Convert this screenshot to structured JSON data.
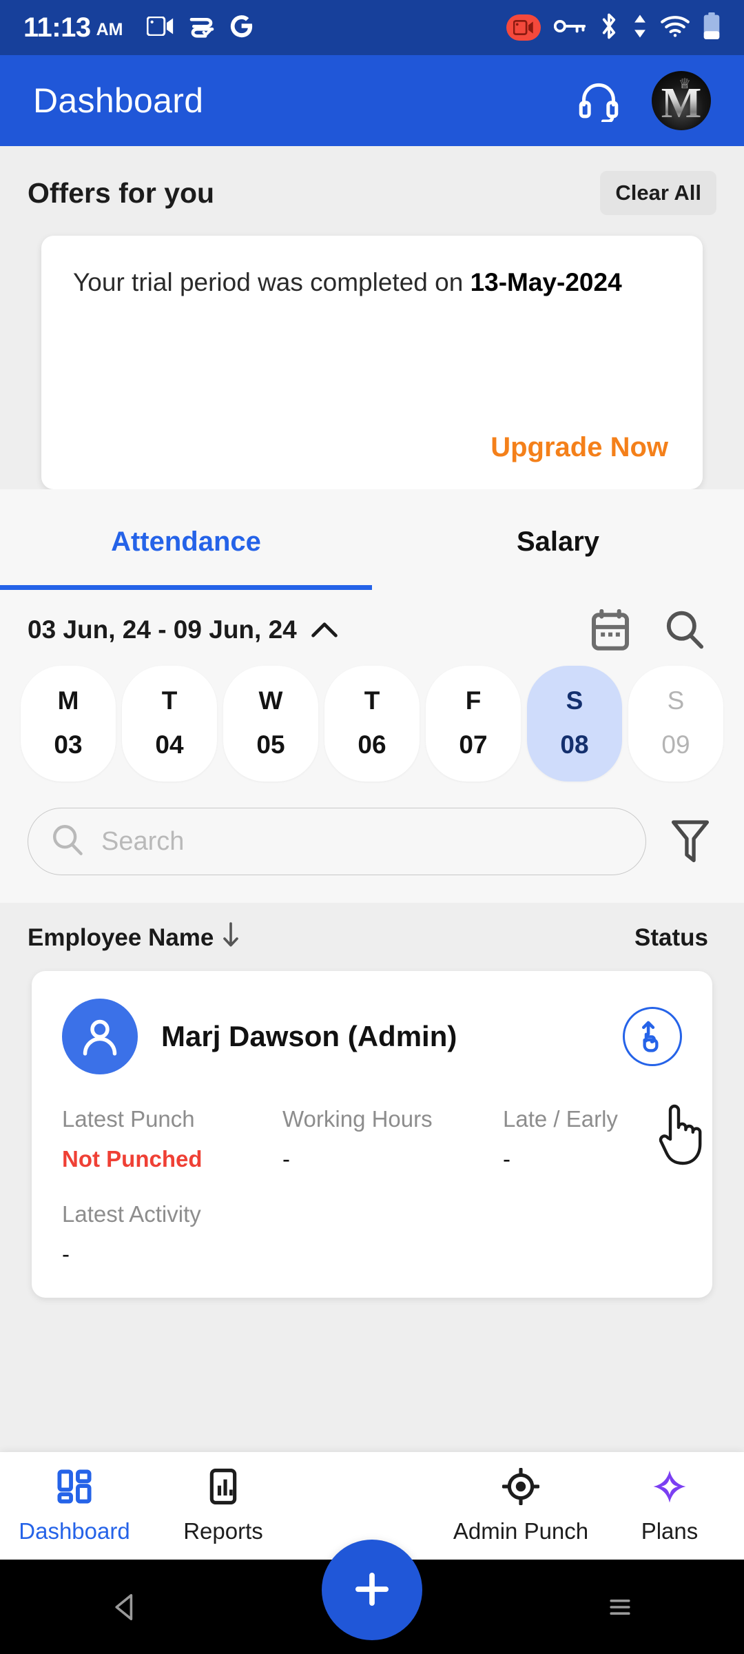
{
  "status_bar": {
    "time": "11:13",
    "ampm": "AM",
    "icons": [
      "screen-cast-icon",
      "android-auto-icon",
      "google-icon"
    ],
    "right_icons": [
      "screen-record-icon",
      "vpn-key-icon",
      "bluetooth-icon",
      "data-transfer-icon",
      "wifi-icon",
      "battery-icon"
    ],
    "record_badge_color": "#f4493c",
    "background": "#17409b"
  },
  "app_bar": {
    "title": "Dashboard",
    "support_icon": "headset-icon",
    "avatar_letter": "M",
    "background": "#2057d8"
  },
  "offers": {
    "title": "Offers for you",
    "clear_all_label": "Clear All",
    "card": {
      "text_prefix": "Your trial period was completed on ",
      "date": "13-May-2024",
      "cta_label": "Upgrade Now",
      "cta_color": "#f4801a"
    }
  },
  "tabs": {
    "items": [
      {
        "label": "Attendance",
        "active": true
      },
      {
        "label": "Salary",
        "active": false
      }
    ],
    "active_color": "#2563e8"
  },
  "attendance": {
    "date_range": "03 Jun, 24 - 09 Jun, 24",
    "range_toggle_icon": "chevron-up-icon",
    "calendar_icon": "calendar-icon",
    "search_icon": "search-icon",
    "days": [
      {
        "dow": "M",
        "num": "03",
        "state": "normal"
      },
      {
        "dow": "T",
        "num": "04",
        "state": "normal"
      },
      {
        "dow": "W",
        "num": "05",
        "state": "normal"
      },
      {
        "dow": "T",
        "num": "06",
        "state": "normal"
      },
      {
        "dow": "F",
        "num": "07",
        "state": "normal"
      },
      {
        "dow": "S",
        "num": "08",
        "state": "selected"
      },
      {
        "dow": "S",
        "num": "09",
        "state": "disabled"
      }
    ],
    "selected_day_bg": "#cfdcfb",
    "search_placeholder": "Search",
    "search_value": "",
    "filter_icon": "filter-funnel-icon",
    "columns": {
      "name_header": "Employee Name",
      "sort_icon": "arrow-down-icon",
      "status_header": "Status"
    },
    "employees": [
      {
        "name": "Marj Dawson (Admin)",
        "avatar_icon": "person-icon",
        "punch_action_icon": "punch-in-icon",
        "fields": {
          "latest_punch_label": "Latest Punch",
          "latest_punch_value": "Not Punched",
          "latest_punch_color": "#ef4035",
          "working_hours_label": "Working Hours",
          "working_hours_value": "-",
          "late_early_label": "Late / Early",
          "late_early_value": "-",
          "latest_activity_label": "Latest Activity",
          "latest_activity_value": "-"
        }
      }
    ]
  },
  "fab": {
    "icon": "plus-icon",
    "color": "#2057d8"
  },
  "bottom_nav": {
    "items": [
      {
        "label": "Dashboard",
        "icon": "grid-dashboard-icon",
        "active": true
      },
      {
        "label": "Reports",
        "icon": "bar-chart-report-icon",
        "active": false
      },
      {
        "label": "Admin Punch",
        "icon": "target-location-icon",
        "active": false
      },
      {
        "label": "Plans",
        "icon": "sparkle-diamond-icon",
        "active": false
      }
    ],
    "active_color": "#2563e8",
    "plans_icon_color": "#7b3ff2"
  },
  "android_nav": {
    "back": "back-triangle-icon",
    "home": "home-square-icon",
    "recents": "recents-lines-icon"
  }
}
